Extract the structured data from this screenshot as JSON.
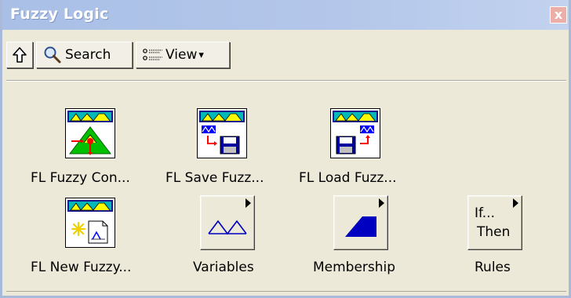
{
  "window": {
    "title": "Fuzzy Logic",
    "close_glyph": "x"
  },
  "toolbar": {
    "up_icon": "up-arrow-icon",
    "search_label": "Search",
    "view_label": "View",
    "view_arrow": "▾"
  },
  "palette": {
    "items": [
      {
        "label": "FL Fuzzy Con...",
        "icon": "fuzzy-controller-icon"
      },
      {
        "label": "FL Save Fuzz...",
        "icon": "save-fuzzy-system-icon"
      },
      {
        "label": "FL Load Fuzz...",
        "icon": "load-fuzzy-system-icon"
      },
      {
        "label": "FL New Fuzzy...",
        "icon": "new-fuzzy-system-icon"
      },
      {
        "label": "Variables",
        "icon": "variables-subpalette-icon"
      },
      {
        "label": "Membership",
        "icon": "membership-subpalette-icon"
      },
      {
        "label": "Rules",
        "icon": "rules-subpalette-icon",
        "glyph_line1": "If...",
        "glyph_line2": "Then"
      }
    ]
  },
  "colors": {
    "title_bar": "#b4c7ea",
    "face": "#ece9d8",
    "fuzzy_green": "#00c000",
    "fuzzy_yellow": "#ffff00",
    "fuzzy_blue": "#0000ff",
    "fuzzy_red": "#ff0000"
  }
}
